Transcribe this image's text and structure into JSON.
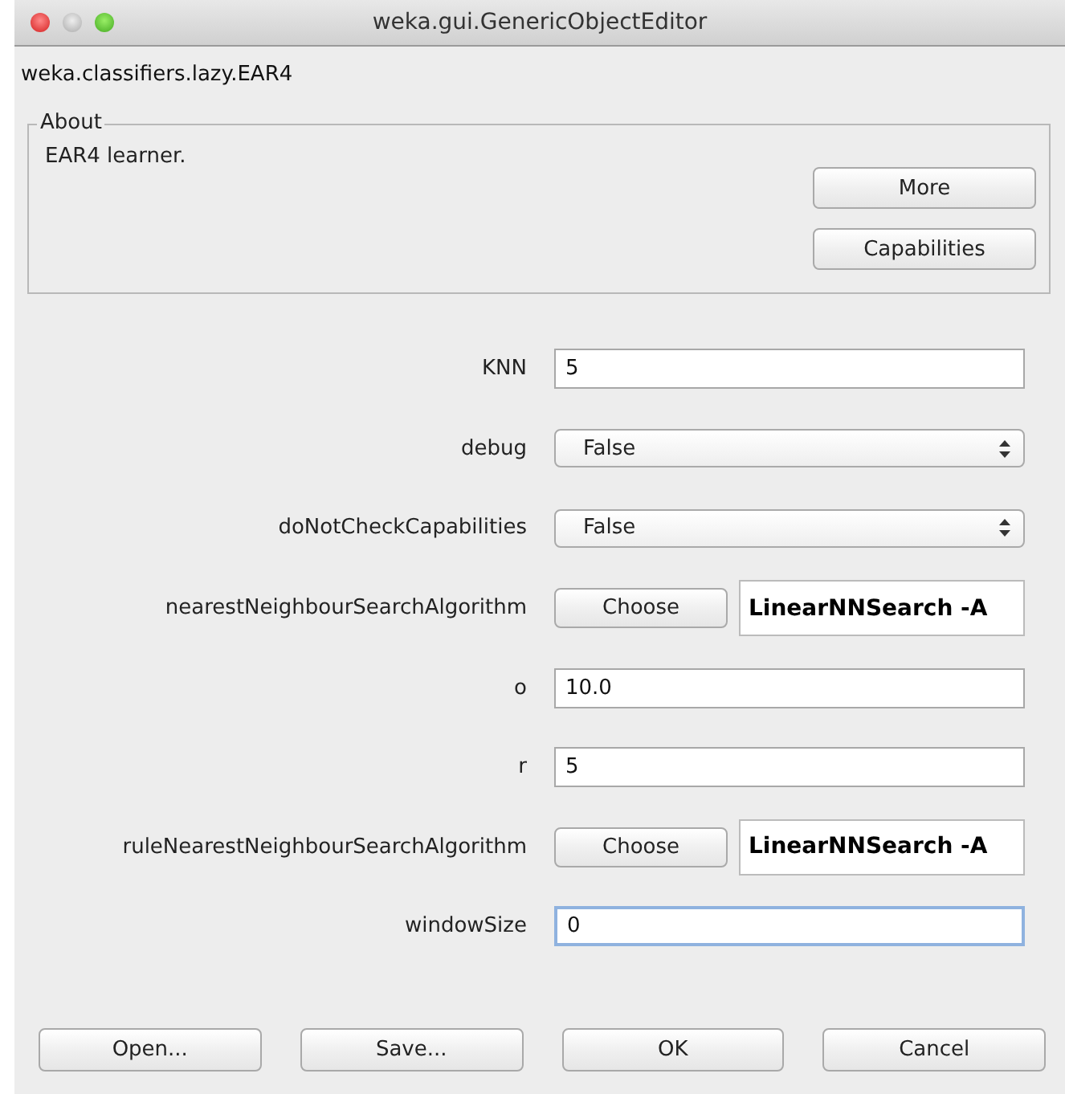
{
  "window": {
    "title": "weka.gui.GenericObjectEditor"
  },
  "class_name": "weka.classifiers.lazy.EAR4",
  "about": {
    "legend": "About",
    "text": "EAR4 learner.",
    "buttons": [
      "More",
      "Capabilities"
    ]
  },
  "properties": [
    {
      "label": "KNN",
      "kind": "text",
      "value": "5",
      "focused": false
    },
    {
      "label": "debug",
      "kind": "choice",
      "value": "False"
    },
    {
      "label": "doNotCheckCapabilities",
      "kind": "choice",
      "value": "False"
    },
    {
      "label": "nearestNeighbourSearchAlgorithm",
      "kind": "object",
      "button": "Choose",
      "value": "LinearNNSearch -A"
    },
    {
      "label": "o",
      "kind": "text",
      "value": "10.0",
      "focused": false
    },
    {
      "label": "r",
      "kind": "text",
      "value": "5",
      "focused": false
    },
    {
      "label": "ruleNearestNeighbourSearchAlgorithm",
      "kind": "object",
      "button": "Choose",
      "value": "LinearNNSearch -A"
    },
    {
      "label": "windowSize",
      "kind": "text",
      "value": "0",
      "focused": true
    }
  ],
  "buttons": [
    "Open...",
    "Save...",
    "OK",
    "Cancel"
  ]
}
